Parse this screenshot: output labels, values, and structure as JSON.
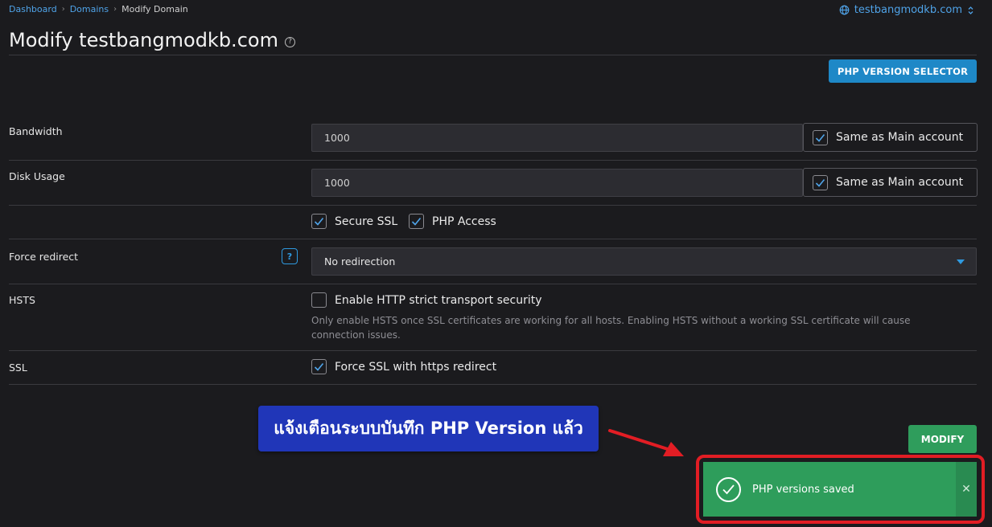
{
  "breadcrumb": {
    "items": [
      "Dashboard",
      "Domains"
    ],
    "current": "Modify Domain"
  },
  "domain_switcher": {
    "label": "testbangmodkb.com"
  },
  "page": {
    "title": "Modify testbangmodkb.com",
    "help_symbol": "?"
  },
  "php_selector_button": "PHP VERSION SELECTOR",
  "bandwidth": {
    "label": "Bandwidth",
    "value": "1000",
    "same_as_main_label": "Same as Main account",
    "same_as_main_checked": true
  },
  "disk_usage": {
    "label": "Disk Usage",
    "value": "1000",
    "same_as_main_label": "Same as Main account",
    "same_as_main_checked": true
  },
  "options": {
    "secure_ssl_label": "Secure SSL",
    "php_access_label": "PHP Access"
  },
  "force_redirect": {
    "label": "Force redirect",
    "help_symbol": "?",
    "selected": "No redirection"
  },
  "hsts": {
    "label": "HSTS",
    "checkbox_label": "Enable HTTP strict transport security",
    "checked": false,
    "hint": "Only enable HSTS once SSL certificates are working for all hosts. Enabling HSTS without a working SSL certificate will cause connection issues."
  },
  "ssl": {
    "label": "SSL",
    "checkbox_label": "Force SSL with https redirect",
    "checked": true
  },
  "modify_button": "MODIFY",
  "annotation": {
    "text": "แจ้งเตือนระบบบันทึก PHP  Version แล้ว"
  },
  "toast": {
    "message": "PHP versions saved",
    "close_symbol": "✕"
  },
  "colors": {
    "background": "#1b1b1e",
    "accent_blue": "#1e88c7",
    "success_green": "#2e9d5b",
    "annotation_blue": "#2036b8",
    "highlight_red": "#e21d24"
  }
}
